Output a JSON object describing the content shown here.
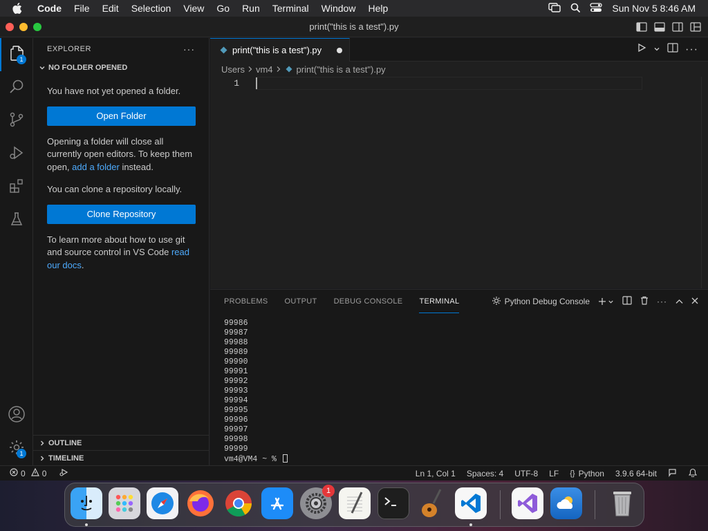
{
  "menubar": {
    "app_name": "Code",
    "items": [
      "File",
      "Edit",
      "Selection",
      "View",
      "Go",
      "Run",
      "Terminal",
      "Window",
      "Help"
    ],
    "clock": "Sun Nov 5  8:46 AM"
  },
  "window": {
    "title": "print(\"this is a test\").py"
  },
  "activity": {
    "explorer_badge": "1",
    "manage_badge": "1"
  },
  "sidebar": {
    "header": "EXPLORER",
    "section": "NO FOLDER OPENED",
    "no_folder_text": "You have not yet opened a folder.",
    "open_folder_label": "Open Folder",
    "opening_text_before": "Opening a folder will close all currently open editors. To keep them open, ",
    "opening_link": "add a folder",
    "opening_text_after": " instead.",
    "clone_text": "You can clone a repository locally.",
    "clone_label": "Clone Repository",
    "learn_text_before": "To learn more about how to use git and source control in VS Code ",
    "learn_link": "read our docs",
    "learn_text_after": ".",
    "outline_label": "OUTLINE",
    "timeline_label": "TIMELINE"
  },
  "editor": {
    "tab_label": "print(\"this is a test\").py",
    "breadcrumb": [
      "Users",
      "vm4",
      "print(\"this is a test\").py"
    ],
    "line_number": "1"
  },
  "panel": {
    "tabs": [
      "PROBLEMS",
      "OUTPUT",
      "DEBUG CONSOLE",
      "TERMINAL"
    ],
    "active_tab": "TERMINAL",
    "terminal_profile": "Python Debug Console",
    "terminal_lines": [
      "99986",
      "99987",
      "99988",
      "99989",
      "99990",
      "99991",
      "99992",
      "99993",
      "99994",
      "99995",
      "99996",
      "99997",
      "99998",
      "99999"
    ],
    "prompt": "vm4@VM4 ~ % "
  },
  "statusbar": {
    "errors": "0",
    "warnings": "0",
    "position": "Ln 1, Col 1",
    "spaces": "Spaces: 4",
    "encoding": "UTF-8",
    "eol": "LF",
    "language": "Python",
    "interpreter": "3.9.6 64-bit"
  },
  "dock": {
    "settings_badge": "1"
  },
  "colors": {
    "accent": "#0078d4",
    "link": "#4daafc",
    "editor_bg": "#1f1f1f",
    "sidebar_bg": "#181818"
  }
}
